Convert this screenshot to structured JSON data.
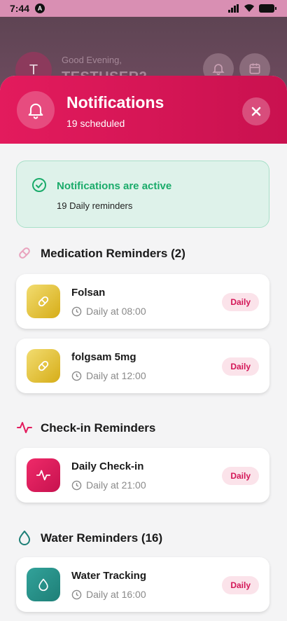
{
  "status_bar": {
    "time": "7:44",
    "app_badge": "A"
  },
  "background": {
    "avatar_letter": "T",
    "greeting": "Good Evening,",
    "username": "TESTUSER2"
  },
  "sheet": {
    "title": "Notifications",
    "subtitle": "19 scheduled",
    "active": {
      "title": "Notifications are active",
      "subtitle": "19 Daily reminders"
    },
    "sections": {
      "medication": {
        "title": "Medication Reminders (2)",
        "items": [
          {
            "name": "Folsan",
            "time": "Daily at 08:00",
            "badge": "Daily"
          },
          {
            "name": "folgsam 5mg",
            "time": "Daily at 12:00",
            "badge": "Daily"
          }
        ]
      },
      "checkin": {
        "title": "Check-in Reminders",
        "items": [
          {
            "name": "Daily Check-in",
            "time": "Daily at 21:00",
            "badge": "Daily"
          }
        ]
      },
      "water": {
        "title": "Water Reminders (16)",
        "items": [
          {
            "name": "Water Tracking",
            "time": "Daily at 16:00",
            "badge": "Daily"
          }
        ]
      }
    }
  },
  "colors": {
    "accent": "#e31b5d",
    "success": "#1aab6a",
    "gold": "#d6ad18",
    "teal": "#1e7f77"
  },
  "icons": [
    "bell-icon",
    "close-icon",
    "check-circle-icon",
    "pill-icon",
    "pulse-icon",
    "droplet-icon",
    "clock-icon",
    "calendar-icon"
  ]
}
